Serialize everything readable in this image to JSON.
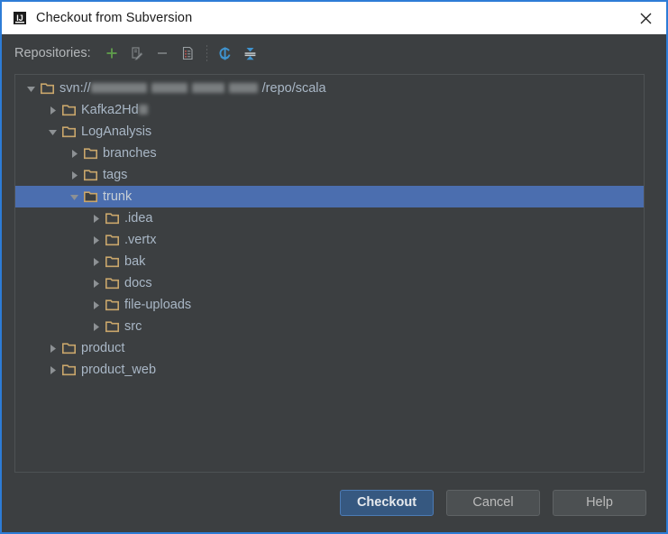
{
  "window": {
    "title": "Checkout from Subversion",
    "app_icon": "intellij-idea-icon",
    "close_label": "×",
    "border_color": "#2d7cd6",
    "background": "#3c3f41"
  },
  "toolbar": {
    "label": "Repositories:",
    "buttons": [
      {
        "name": "add-repository-button",
        "icon": "plus-icon",
        "color": "#6a9e4f"
      },
      {
        "name": "edit-repository-button",
        "icon": "edit-pencil-icon",
        "color": "#7a7e80"
      },
      {
        "name": "remove-repository-button",
        "icon": "minus-icon",
        "color": "#7a7e80"
      },
      {
        "name": "repository-details-button",
        "icon": "document-list-icon",
        "color": "#9aa0a3"
      },
      {
        "name": "refresh-button",
        "icon": "refresh-circular-arrow-icon",
        "color": "#3592c4"
      },
      {
        "name": "collapse-all-button",
        "icon": "collapse-all-icon",
        "color": "#3592c4"
      }
    ]
  },
  "tree": {
    "selection_color": "#4b6eaf",
    "folder_color": "#c9a66b",
    "text_color": "#a9b7c6",
    "nodes": [
      {
        "label_prefix": "svn://",
        "label_suffix": "/repo/scala",
        "redacted": true,
        "depth": 0,
        "state": "expanded",
        "selected": false
      },
      {
        "label_prefix": "Kafka2Hd",
        "label_suffix": "",
        "redacted": true,
        "depth": 1,
        "state": "collapsed",
        "selected": false
      },
      {
        "label_prefix": "LogAnalysis",
        "label_suffix": "",
        "redacted": false,
        "depth": 1,
        "state": "expanded",
        "selected": false
      },
      {
        "label_prefix": "branches",
        "label_suffix": "",
        "redacted": false,
        "depth": 2,
        "state": "collapsed",
        "selected": false
      },
      {
        "label_prefix": "tags",
        "label_suffix": "",
        "redacted": false,
        "depth": 2,
        "state": "collapsed",
        "selected": false
      },
      {
        "label_prefix": "trunk",
        "label_suffix": "",
        "redacted": false,
        "depth": 2,
        "state": "expanded",
        "selected": true
      },
      {
        "label_prefix": ".idea",
        "label_suffix": "",
        "redacted": false,
        "depth": 3,
        "state": "collapsed",
        "selected": false
      },
      {
        "label_prefix": ".vertx",
        "label_suffix": "",
        "redacted": false,
        "depth": 3,
        "state": "collapsed",
        "selected": false
      },
      {
        "label_prefix": "bak",
        "label_suffix": "",
        "redacted": false,
        "depth": 3,
        "state": "collapsed",
        "selected": false
      },
      {
        "label_prefix": "docs",
        "label_suffix": "",
        "redacted": false,
        "depth": 3,
        "state": "collapsed",
        "selected": false
      },
      {
        "label_prefix": "file-uploads",
        "label_suffix": "",
        "redacted": false,
        "depth": 3,
        "state": "collapsed",
        "selected": false
      },
      {
        "label_prefix": "src",
        "label_suffix": "",
        "redacted": false,
        "depth": 3,
        "state": "collapsed",
        "selected": false
      },
      {
        "label_prefix": "product",
        "label_suffix": "",
        "redacted": false,
        "depth": 1,
        "state": "collapsed",
        "selected": false
      },
      {
        "label_prefix": "product_web",
        "label_suffix": "",
        "redacted": false,
        "depth": 1,
        "state": "collapsed",
        "selected": false
      }
    ]
  },
  "footer": {
    "checkout_label": "Checkout",
    "cancel_label": "Cancel",
    "help_label": "Help",
    "default_button_color": "#365880"
  }
}
